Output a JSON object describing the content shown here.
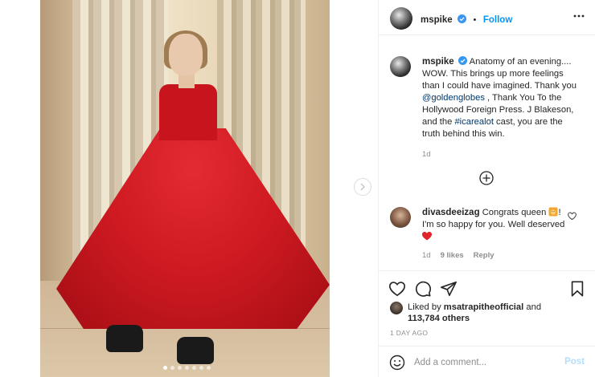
{
  "post": {
    "username": "mspike",
    "follow_label": "Follow",
    "header_separator": "•",
    "photo_dots": 7,
    "active_dot": 0
  },
  "caption": {
    "username": "mspike",
    "text_1": "Anatomy of an evening.... WOW. This brings up more feelings than I could have imagined. Thank you ",
    "mention": "@goldenglobes",
    "text_2": " , Thank You To the Hollywood Foreign Press. J Blakeson, and the ",
    "hashtag": "#icarealot",
    "text_3": " cast, you are the truth behind this win.",
    "age": "1d"
  },
  "comment": {
    "username": "divasdeeizag",
    "text_1": "Congrats queen ",
    "text_2": "! I'm so happy for you. Well deserved ",
    "age": "1d",
    "likes": "9 likes",
    "reply_label": "Reply"
  },
  "likes": {
    "prefix": "Liked by ",
    "user": "msatrapitheofficial",
    "and": " and",
    "count": "113,784 others"
  },
  "timestamp": "1 DAY AGO",
  "add_comment": {
    "placeholder": "Add a comment...",
    "post_label": "Post"
  },
  "colors": {
    "link": "#00376b",
    "follow": "#0095f6",
    "post_disabled": "#b2dffc",
    "heart_red": "#ed4956",
    "dress_red": "#c8141c"
  },
  "icons": [
    "verified-badge-icon",
    "more-options-icon",
    "next-arrow-icon",
    "add-circle-icon",
    "heart-outline-icon",
    "comment-icon",
    "share-icon",
    "bookmark-icon",
    "emoji-icon",
    "lion-emoji-icon",
    "red-heart-emoji-icon"
  ]
}
